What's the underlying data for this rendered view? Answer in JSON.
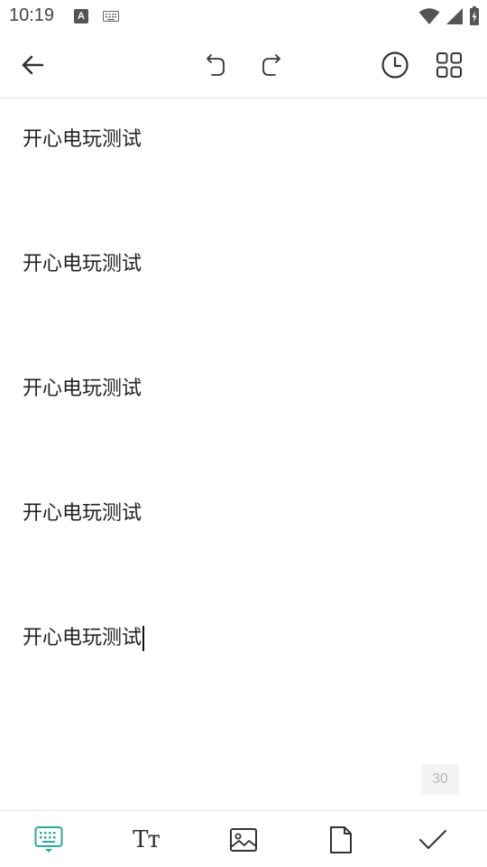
{
  "status_bar": {
    "time": "10:19",
    "a_badge": "A",
    "icons": [
      "keyboard-icon",
      "wifi-icon",
      "signal-icon",
      "battery-icon"
    ]
  },
  "toolbar": {
    "icons": [
      "back-arrow-icon",
      "undo-icon",
      "redo-icon",
      "clock-icon",
      "grid-icon"
    ]
  },
  "note": {
    "lines": [
      "开心电玩测试",
      "开心电玩测试",
      "开心电玩测试",
      "开心电玩测试",
      "开心电玩测试"
    ],
    "char_count": "30"
  },
  "bottom_bar": {
    "text_style_label": "Tт",
    "icons": [
      "keyboard-icon",
      "text-format-icon",
      "image-icon",
      "file-icon",
      "check-icon"
    ],
    "accent_color": "#2aa9a0"
  }
}
